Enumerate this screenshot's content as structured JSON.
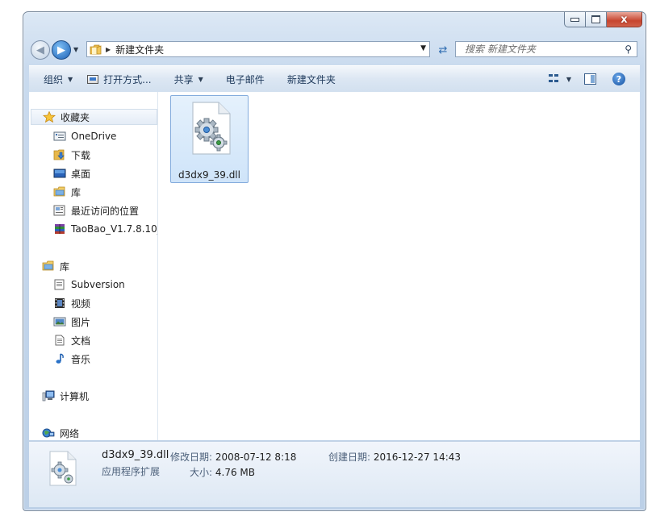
{
  "window": {
    "caption_buttons": {
      "minimize": "minimize",
      "maximize": "maximize",
      "close": "x"
    }
  },
  "address_bar": {
    "path": "新建文件夹",
    "search_placeholder": "搜索 新建文件夹"
  },
  "toolbar": {
    "organize": "组织",
    "open_with": "打开方式...",
    "share": "共享",
    "email": "电子邮件",
    "new_folder": "新建文件夹"
  },
  "nav": {
    "favorites_header": "收藏夹",
    "favorites": [
      "OneDrive",
      "下载",
      "桌面",
      "库",
      "最近访问的位置",
      "TaoBao_V1.7.8.10_"
    ],
    "libraries_header": "库",
    "libraries": [
      "Subversion",
      "视频",
      "图片",
      "文档",
      "音乐"
    ],
    "computer": "计算机",
    "network": "网络"
  },
  "files": [
    {
      "name": "d3dx9_39.dll",
      "icon": "gear-file-icon",
      "selected": true
    }
  ],
  "details": {
    "name": "d3dx9_39.dll",
    "type": "应用程序扩展",
    "modified_label": "修改日期:",
    "modified": "2008-07-12 8:18",
    "created_label": "创建日期:",
    "created": "2016-12-27 14:43",
    "size_label": "大小:",
    "size": "4.76 MB"
  },
  "colors": {
    "chrome": "#c9daee",
    "selection": "#cfe4f9",
    "close": "#c7452f"
  }
}
